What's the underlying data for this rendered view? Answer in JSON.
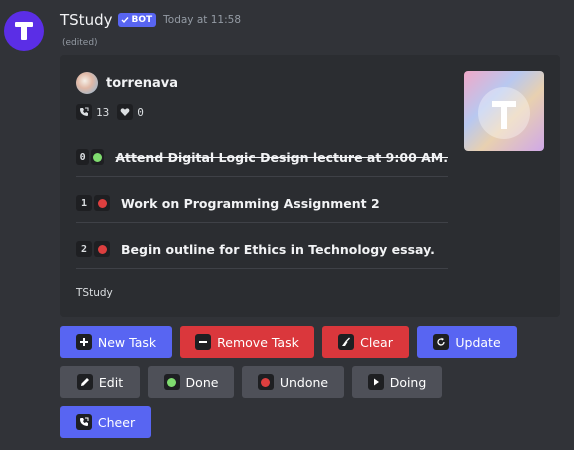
{
  "message": {
    "author": "TStudy",
    "bot_tag": "BOT",
    "timestamp": "Today at 11:58",
    "edited": "(edited)"
  },
  "embed": {
    "author_name": "torrenava",
    "stats": {
      "cheers": "13",
      "likes": "0"
    },
    "tasks": [
      {
        "num": "0",
        "text": "Attend Digital Logic Design lecture at 9:00 AM.",
        "status": "done",
        "status_color": "#7fdc6f"
      },
      {
        "num": "1",
        "text": "Work on Programming Assignment 2",
        "status": "undone",
        "status_color": "#dd3f3f"
      },
      {
        "num": "2",
        "text": "Begin outline for Ethics in Technology essay.",
        "status": "undone",
        "status_color": "#dd3f3f"
      }
    ],
    "footer": "TStudy"
  },
  "buttons": {
    "new_task": "New Task",
    "remove_task": "Remove Task",
    "clear": "Clear",
    "update": "Update",
    "edit": "Edit",
    "done": "Done",
    "undone": "Undone",
    "doing": "Doing",
    "cheer": "Cheer"
  },
  "colors": {
    "background": "#313338",
    "embed": "#2b2d31",
    "primary": "#5865f2",
    "danger": "#da373c",
    "secondary": "#4e5058",
    "brand_avatar": "#5b2ee6"
  }
}
